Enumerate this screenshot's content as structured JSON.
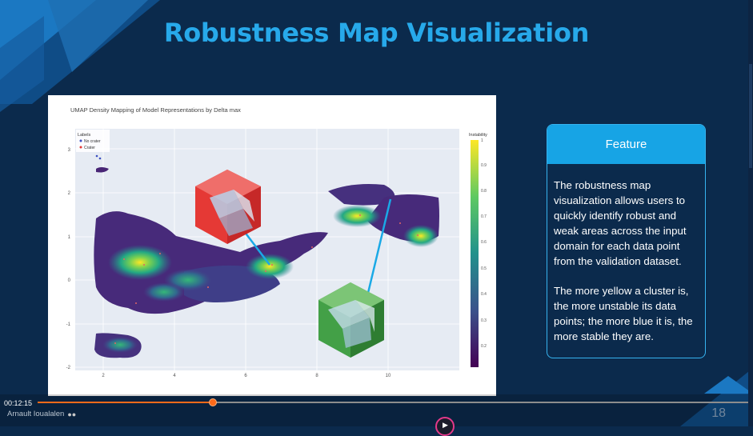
{
  "slide": {
    "title": "Robustness Map Visualization",
    "number": "18",
    "colors": {
      "background": "#0b2a4c",
      "accent": "#27a9ea",
      "panel_header": "#17a4e5"
    }
  },
  "figure": {
    "title": "UMAP Density Mapping of Model Representations by Delta max",
    "legend_title": "Labels",
    "legend_items": [
      "No crater",
      "Crater"
    ],
    "colorbar_title": "Instability",
    "colorbar_ticks": [
      "1",
      "0.9",
      "0.8",
      "0.7",
      "0.6",
      "0.5",
      "0.4",
      "0.3",
      "0.2"
    ],
    "x_ticks": [
      "2",
      "4",
      "6",
      "8",
      "10"
    ],
    "y_ticks": [
      "3",
      "2",
      "1",
      "0",
      "-1",
      "-2"
    ],
    "callout_colors": [
      "#e53935",
      "#43a047"
    ],
    "callout_line_color": "#1aa9e6"
  },
  "feature": {
    "header": "Feature",
    "paragraph1": "The robustness map visualization allows users to quickly identify robust and weak areas across the input domain for each data point from the validation dataset.",
    "paragraph2": "The more yellow a cluster is, the more unstable its data points; the more blue it is, the more stable they are."
  },
  "player": {
    "timecode": "00:12:15",
    "progress": 0.245,
    "presenter": "Arnault Ioualalen",
    "presenter_icon": "people-icon",
    "accent": "#ff6a1a"
  }
}
